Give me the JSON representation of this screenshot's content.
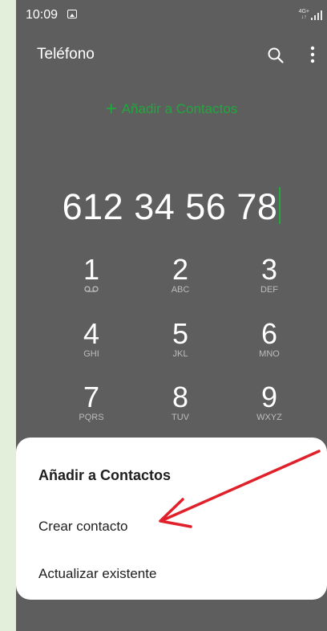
{
  "status_bar": {
    "time": "10:09",
    "network_top": "4G+",
    "network_bottom": "↓↑"
  },
  "app_bar": {
    "title": "Teléfono"
  },
  "add_to_contacts_link": {
    "plus": "+",
    "label": "Añadir a Contactos"
  },
  "dialed_number": "612 34 56 78",
  "keypad": [
    {
      "digit": "1",
      "letters": ""
    },
    {
      "digit": "2",
      "letters": "ABC"
    },
    {
      "digit": "3",
      "letters": "DEF"
    },
    {
      "digit": "4",
      "letters": "GHI"
    },
    {
      "digit": "5",
      "letters": "JKL"
    },
    {
      "digit": "6",
      "letters": "MNO"
    },
    {
      "digit": "7",
      "letters": "PQRS"
    },
    {
      "digit": "8",
      "letters": "TUV"
    },
    {
      "digit": "9",
      "letters": "WXYZ"
    }
  ],
  "sheet": {
    "title": "Añadir a Contactos",
    "options": [
      "Crear contacto",
      "Actualizar existente"
    ]
  },
  "colors": {
    "accent_green": "#1fa83c",
    "annotation_arrow": "#e0202a",
    "overlay": "#5e5e5e"
  }
}
